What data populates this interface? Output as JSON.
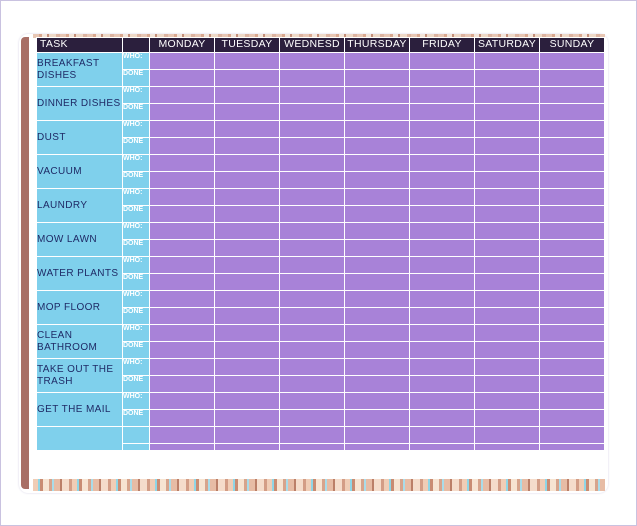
{
  "header": {
    "task": "TASK",
    "days": [
      "MONDAY",
      "TUESDAY",
      "WEDNESD",
      "THURSDAY",
      "FRIDAY",
      "SATURDAY",
      "SUNDAY"
    ]
  },
  "sub_labels": {
    "who": "WHO:",
    "done": "DONE"
  },
  "tasks": [
    "BREAKFAST DISHES",
    "DINNER DISHES",
    "DUST",
    "VACUUM",
    "LAUNDRY",
    "MOW LAWN",
    "WATER PLANTS",
    "MOP FLOOR",
    "CLEAN BATHROOM",
    "TAKE OUT THE TRASH",
    "GET THE MAIL"
  ],
  "colors": {
    "header_bg": "#2b1f3d",
    "task_bg": "#7fd0ec",
    "task_text": "#1f2a66",
    "grid_bg": "#a882d8",
    "left_bar": "#a86f66"
  }
}
